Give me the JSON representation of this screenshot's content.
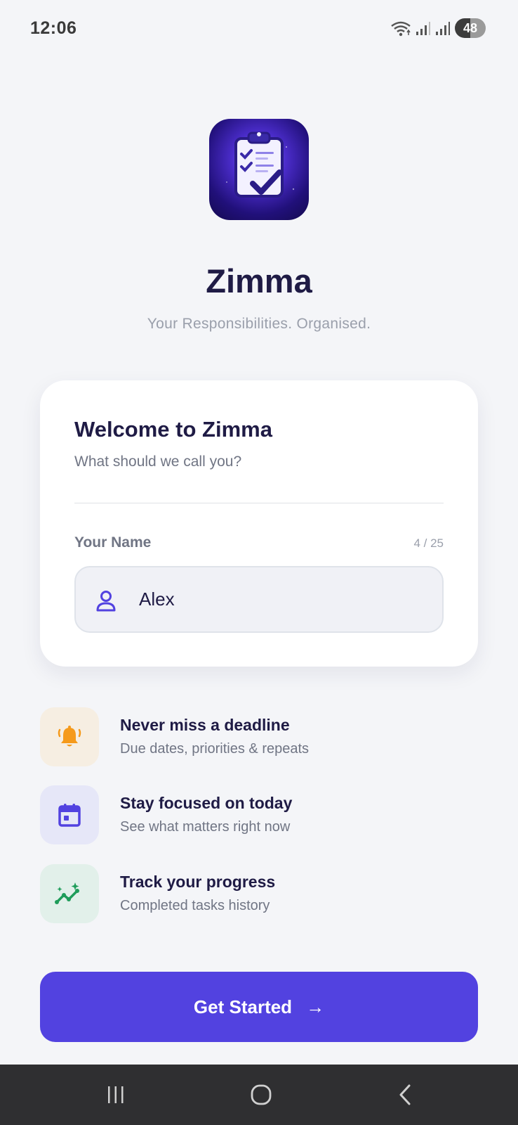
{
  "status_bar": {
    "time": "12:06",
    "battery": "48"
  },
  "app": {
    "title": "Zimma",
    "tagline": "Your Responsibilities. Organised."
  },
  "welcome_card": {
    "title": "Welcome to Zimma",
    "subtitle": "What should we call you?",
    "field_label": "Your Name",
    "counter": "4 / 25",
    "name_value": "Alex"
  },
  "features": [
    {
      "title": "Never miss a deadline",
      "description": "Due dates, priorities & repeats",
      "icon": "bell-icon",
      "color": "#f59a1b",
      "bg": "#f6eee2"
    },
    {
      "title": "Stay focused on today",
      "description": "See what matters right now",
      "icon": "calendar-icon",
      "color": "#5242e0",
      "bg": "#e6e7f8"
    },
    {
      "title": "Track your progress",
      "description": "Completed tasks history",
      "icon": "trend-icon",
      "color": "#1f9d5a",
      "bg": "#e2f0ea"
    }
  ],
  "cta": {
    "label": "Get Started",
    "arrow": "→"
  },
  "colors": {
    "accent": "#5242e0",
    "background": "#f4f5f8",
    "heading": "#1f1b45"
  }
}
